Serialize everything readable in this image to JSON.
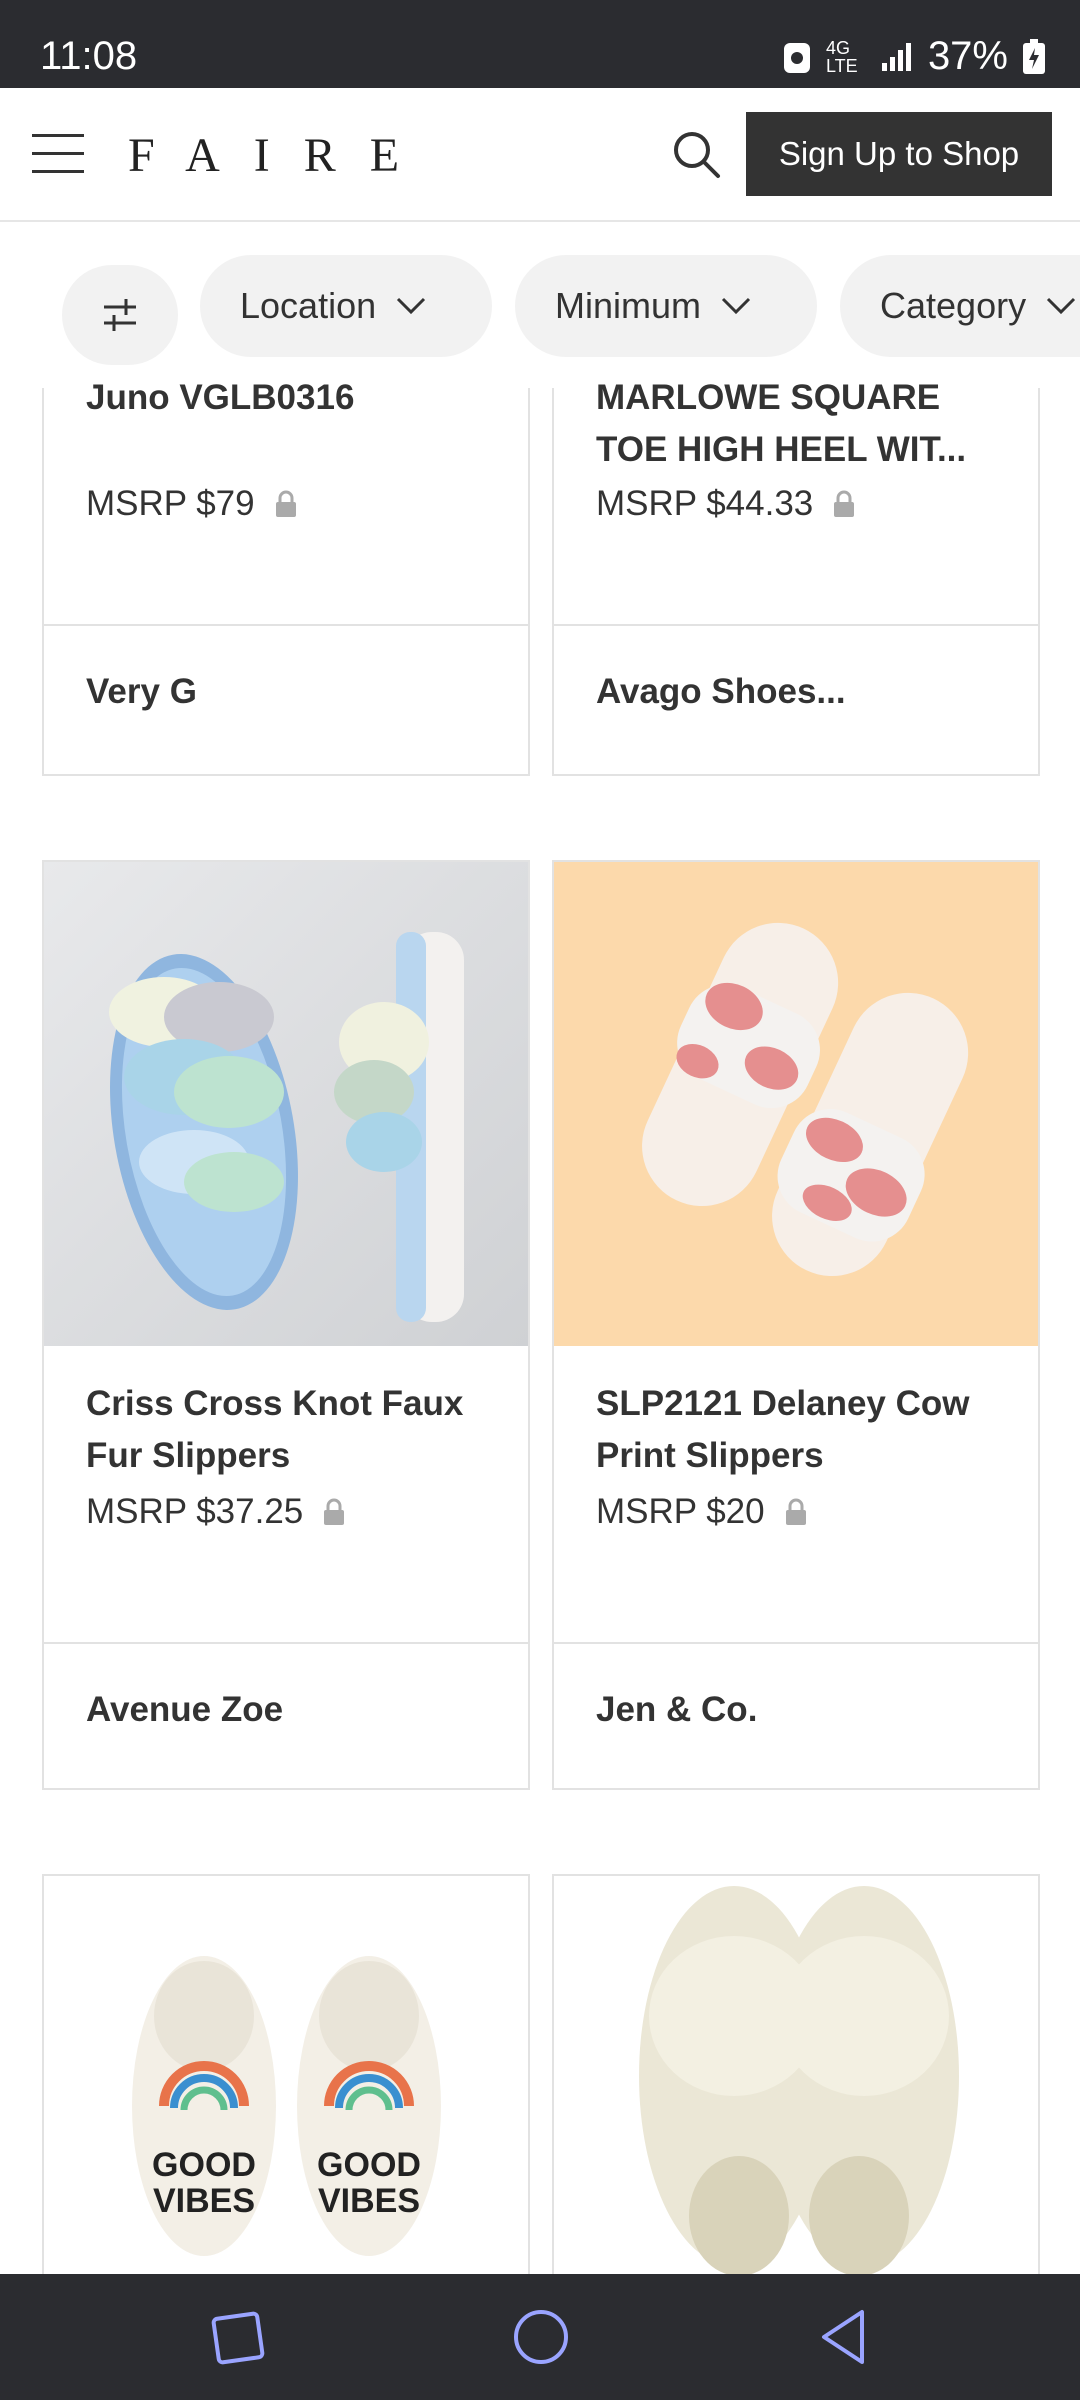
{
  "status": {
    "time": "11:08",
    "battery": "37%",
    "network": "4G LTE"
  },
  "header": {
    "logo": "FAIRE",
    "signup": "Sign Up to Shop",
    "menu_icon": "menu-icon",
    "search_icon": "search-icon"
  },
  "filters": {
    "chips": [
      {
        "label": "Location"
      },
      {
        "label": "Minimum"
      },
      {
        "label": "Category"
      }
    ]
  },
  "products": [
    {
      "title": "Juno VGLB0316",
      "price": "MSRP $79",
      "brand": "Very G"
    },
    {
      "title": "MARLOWE SQUARE TOE HIGH HEEL WIT...",
      "price": "MSRP $44.33",
      "brand": "Avago Shoes..."
    },
    {
      "title": "Criss Cross Knot Faux Fur Slippers",
      "price": "MSRP $37.25",
      "brand": "Avenue Zoe"
    },
    {
      "title": "SLP2121 Delaney Cow Print Slippers",
      "price": "MSRP $20",
      "brand": "Jen & Co."
    },
    {
      "image_text": "GOOD VIBES"
    },
    {
      "image_text": ""
    }
  ],
  "colors": {
    "accent": "#333333",
    "status_bar": "#2b2c30",
    "chip_bg": "#f2f2f2",
    "border": "#e2e2e2"
  }
}
